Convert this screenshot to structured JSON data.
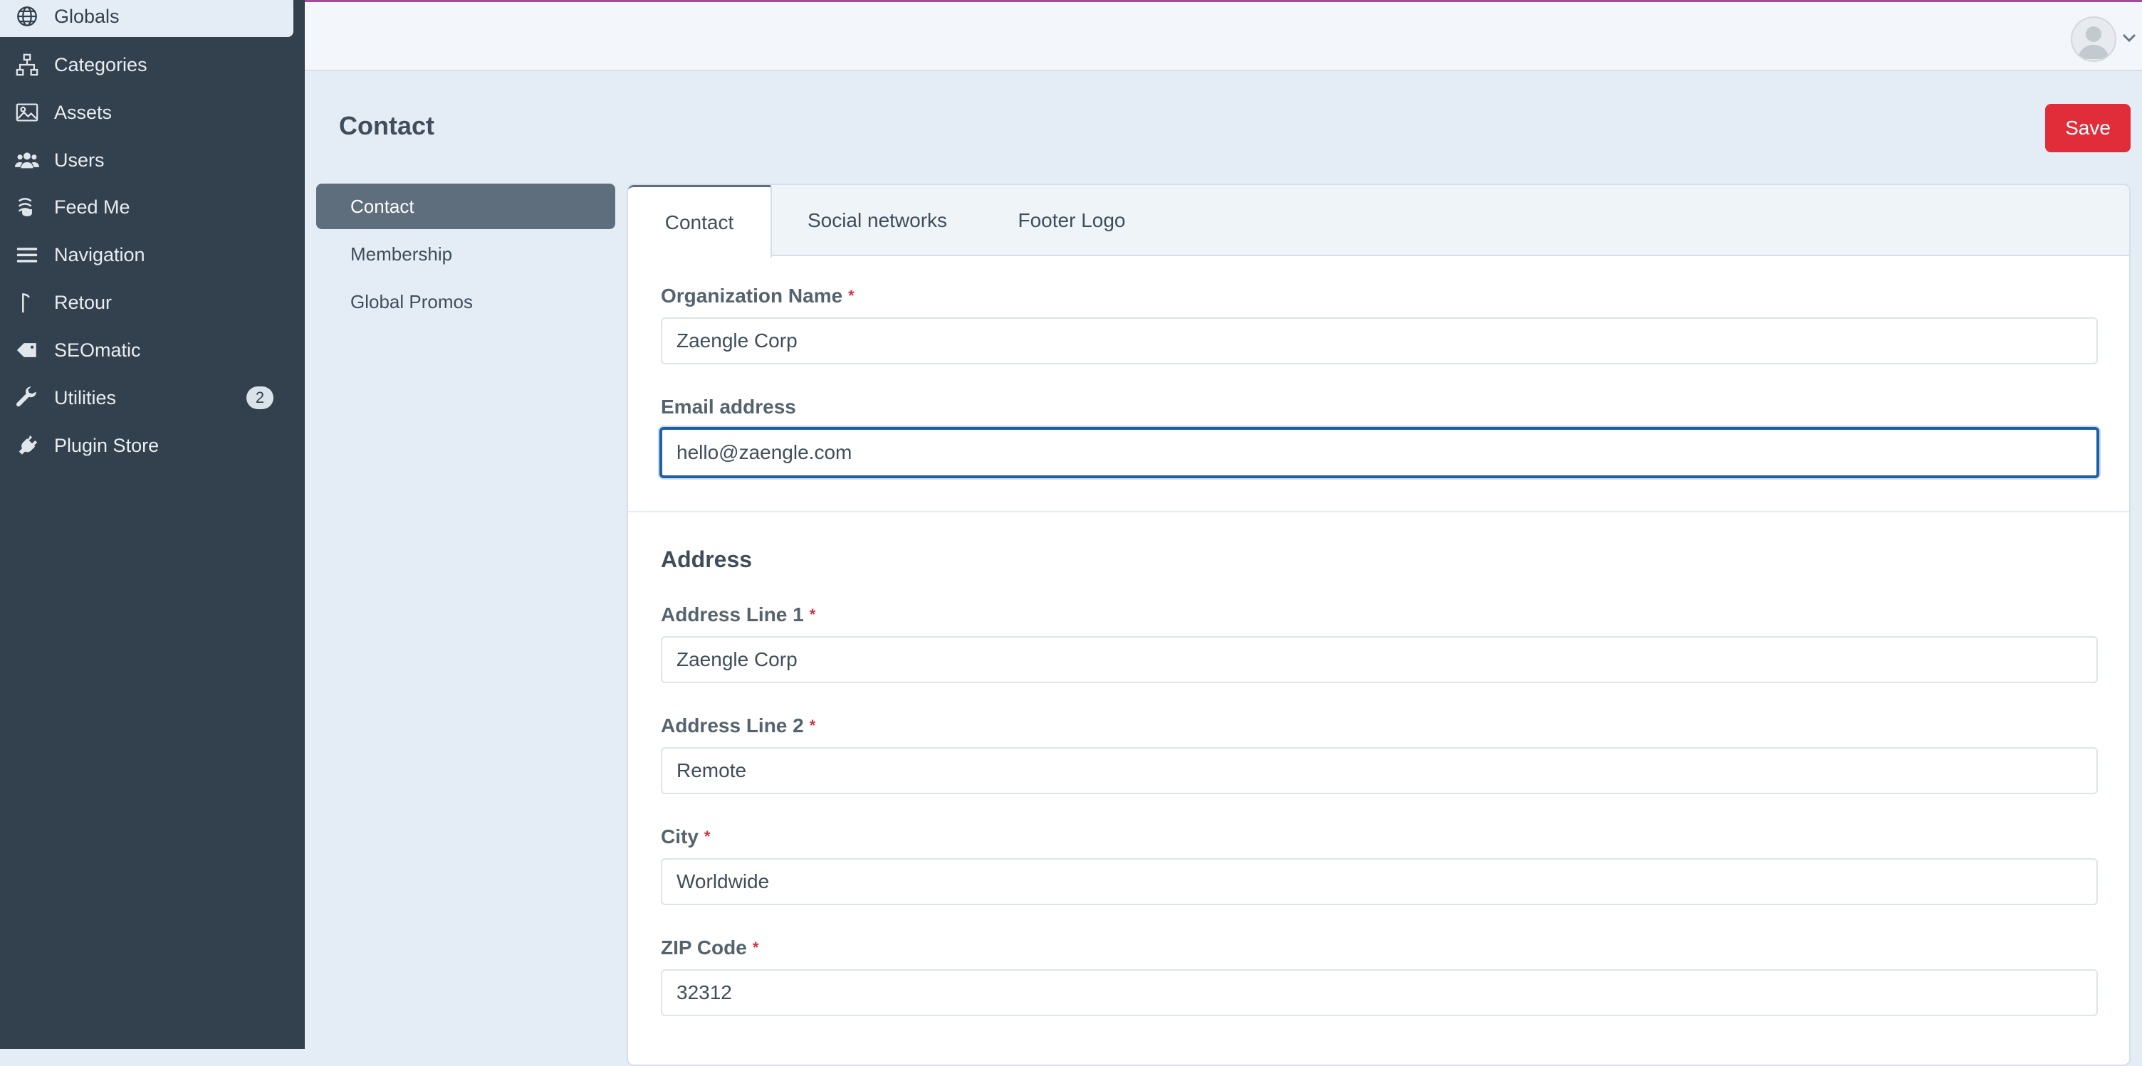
{
  "sidebar": {
    "items": [
      {
        "label": "Globals",
        "icon": "globe-icon",
        "active": true
      },
      {
        "label": "Categories",
        "icon": "sitemap-icon"
      },
      {
        "label": "Assets",
        "icon": "image-icon"
      },
      {
        "label": "Users",
        "icon": "users-icon"
      },
      {
        "label": "Feed Me",
        "icon": "feedme-icon"
      },
      {
        "label": "Navigation",
        "icon": "bars-icon"
      },
      {
        "label": "Retour",
        "icon": "signpost-icon"
      },
      {
        "label": "SEOmatic",
        "icon": "tag-icon"
      },
      {
        "label": "Utilities",
        "icon": "wrench-icon",
        "badge": "2"
      },
      {
        "label": "Plugin Store",
        "icon": "plug-icon"
      }
    ]
  },
  "header": {
    "page_title": "Contact",
    "save_label": "Save"
  },
  "subnav": {
    "items": [
      {
        "label": "Contact",
        "active": true
      },
      {
        "label": "Membership"
      },
      {
        "label": "Global Promos"
      }
    ]
  },
  "tabs": [
    {
      "label": "Contact",
      "active": true
    },
    {
      "label": "Social networks"
    },
    {
      "label": "Footer Logo"
    }
  ],
  "form": {
    "organization_name": {
      "label": "Organization Name",
      "required": "*",
      "value": "Zaengle Corp"
    },
    "email": {
      "label": "Email address",
      "value": "hello@zaengle.com"
    },
    "address_heading": "Address",
    "address_line1": {
      "label": "Address Line 1",
      "required": "*",
      "value": "Zaengle Corp"
    },
    "address_line2": {
      "label": "Address Line 2",
      "required": "*",
      "value": "Remote"
    },
    "city": {
      "label": "City",
      "required": "*",
      "value": "Worldwide"
    },
    "zip": {
      "label": "ZIP Code",
      "required": "*",
      "value": "32312"
    }
  },
  "colors": {
    "sidebar_bg": "#33404d",
    "save_button": "#e12d39",
    "focus_border": "#1f5fa6"
  }
}
